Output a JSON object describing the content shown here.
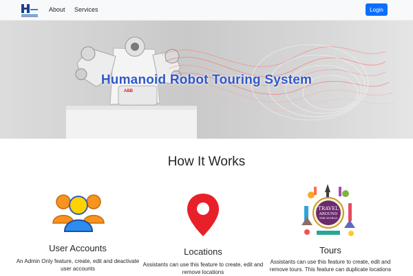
{
  "nav": {
    "about_label": "About",
    "services_label": "Services",
    "login_label": "Login"
  },
  "hero": {
    "title": "Humanoid Robot Touring System"
  },
  "section": {
    "title": "How It Works"
  },
  "features": [
    {
      "title": "User Accounts",
      "description": "An Admin Only feature, create, edit and deactivate user accounts",
      "icon": "users-icon"
    },
    {
      "title": "Locations",
      "description": "Assistants can use this feature to create, edit and remove locations",
      "icon": "location-pin-icon"
    },
    {
      "title": "Tours",
      "description": "Assistants can use this feature to create, edit and remove tours. This feature can duplicate locations",
      "icon": "travel-around-the-world-icon",
      "icon_text": "TRAVEL AROUND THE WORLD"
    }
  ],
  "colors": {
    "primary": "#0d6efd",
    "hero_title": "#3058c8",
    "pin": "#e8202a",
    "navbar_bg": "#f8f9fa"
  }
}
